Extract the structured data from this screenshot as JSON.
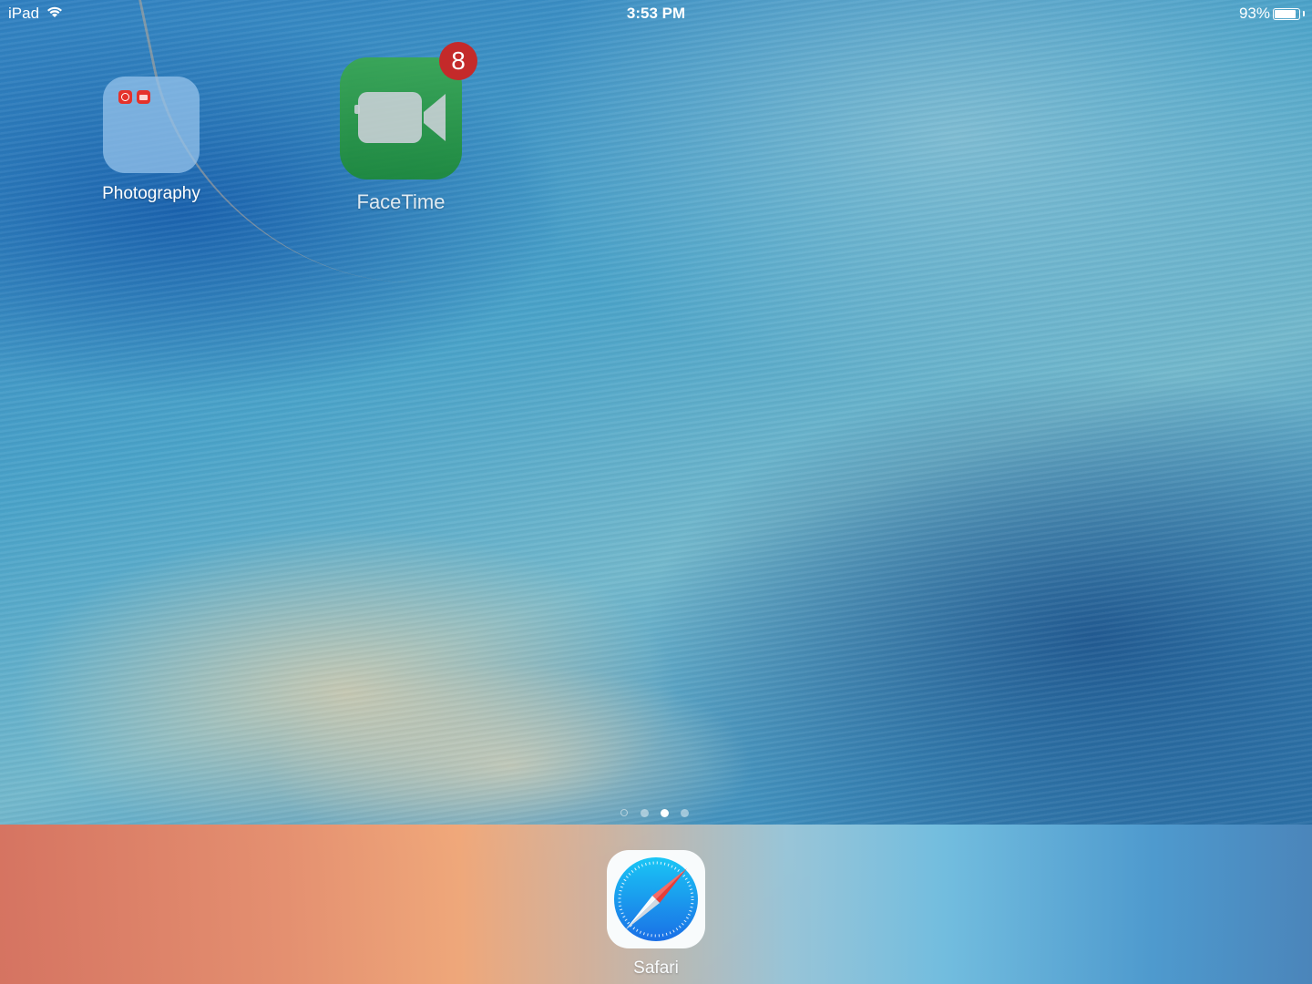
{
  "statusbar": {
    "device": "iPad",
    "time": "3:53 PM",
    "battery_percent": "93%",
    "battery_level": 0.93,
    "wifi_icon": "wifi-icon",
    "battery_icon": "battery-icon"
  },
  "home": {
    "apps": [
      {
        "label": "Photography",
        "type": "folder"
      },
      {
        "label": "FaceTime",
        "type": "app",
        "badge": "8",
        "icon": "video-camera-icon",
        "color": "#2a9a45"
      }
    ],
    "page_dots": {
      "count": 4,
      "active_index": 2,
      "first_is_search": true
    }
  },
  "dock": {
    "apps": [
      {
        "label": "Safari",
        "icon": "compass-icon"
      }
    ]
  },
  "colors": {
    "badge": "#c42a2a",
    "safari_blue": "#1a8cf0",
    "safari_needle_red": "#ef3b33"
  }
}
